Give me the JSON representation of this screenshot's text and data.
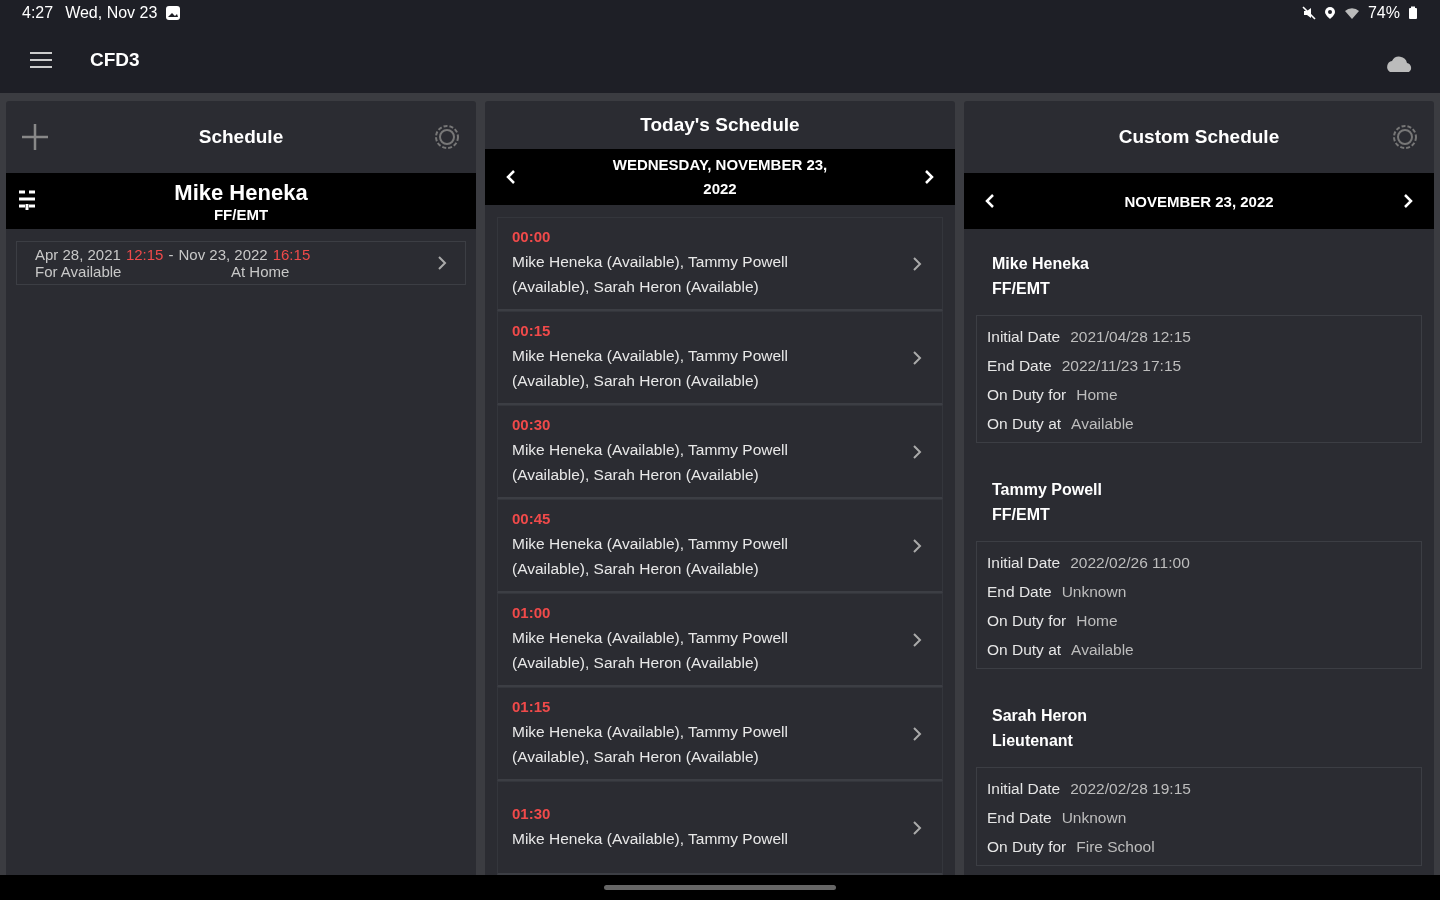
{
  "status_bar": {
    "time": "4:27",
    "date": "Wed, Nov 23",
    "battery": "74%"
  },
  "app_bar": {
    "title": "CFD3"
  },
  "schedule_panel": {
    "title": "Schedule",
    "member": {
      "name": "Mike Heneka",
      "role": "FF/EMT"
    },
    "entries": [
      {
        "start_date": "Apr 28, 2021",
        "start_time": "12:15",
        "separator": "-",
        "end_date": "Nov 23, 2022",
        "end_time": "16:15",
        "for": "For Available",
        "at": "At Home"
      }
    ]
  },
  "todays_panel": {
    "title": "Today's Schedule",
    "date": "WEDNESDAY, NOVEMBER 23, 2022",
    "slots": [
      {
        "time": "00:00",
        "text": "Mike Heneka (Available), Tammy Powell (Available), Sarah Heron (Available)"
      },
      {
        "time": "00:15",
        "text": "Mike Heneka (Available), Tammy Powell (Available), Sarah Heron (Available)"
      },
      {
        "time": "00:30",
        "text": "Mike Heneka (Available), Tammy Powell (Available), Sarah Heron (Available)"
      },
      {
        "time": "00:45",
        "text": "Mike Heneka (Available), Tammy Powell (Available), Sarah Heron (Available)"
      },
      {
        "time": "01:00",
        "text": "Mike Heneka (Available), Tammy Powell (Available), Sarah Heron (Available)"
      },
      {
        "time": "01:15",
        "text": "Mike Heneka (Available), Tammy Powell (Available), Sarah Heron (Available)"
      },
      {
        "time": "01:30",
        "text": "Mike Heneka (Available), Tammy Powell"
      }
    ]
  },
  "custom_panel": {
    "title": "Custom Schedule",
    "date": "NOVEMBER 23, 2022",
    "people": [
      {
        "name": "Mike Heneka",
        "role": "FF/EMT",
        "details": [
          {
            "label": "Initial Date",
            "value": "2021/04/28 12:15"
          },
          {
            "label": "End Date",
            "value": "2022/11/23 17:15"
          },
          {
            "label": "On Duty for",
            "value": "Home"
          },
          {
            "label": "On Duty at",
            "value": "Available"
          }
        ]
      },
      {
        "name": "Tammy Powell",
        "role": "FF/EMT",
        "details": [
          {
            "label": "Initial Date",
            "value": "2022/02/26 11:00"
          },
          {
            "label": "End Date",
            "value": "Unknown"
          },
          {
            "label": "On Duty for",
            "value": "Home"
          },
          {
            "label": "On Duty at",
            "value": "Available"
          }
        ]
      },
      {
        "name": "Sarah Heron",
        "role": "Lieutenant",
        "details": [
          {
            "label": "Initial Date",
            "value": "2022/02/28 19:15"
          },
          {
            "label": "End Date",
            "value": "Unknown"
          },
          {
            "label": "On Duty for",
            "value": "Fire School"
          }
        ]
      }
    ]
  }
}
